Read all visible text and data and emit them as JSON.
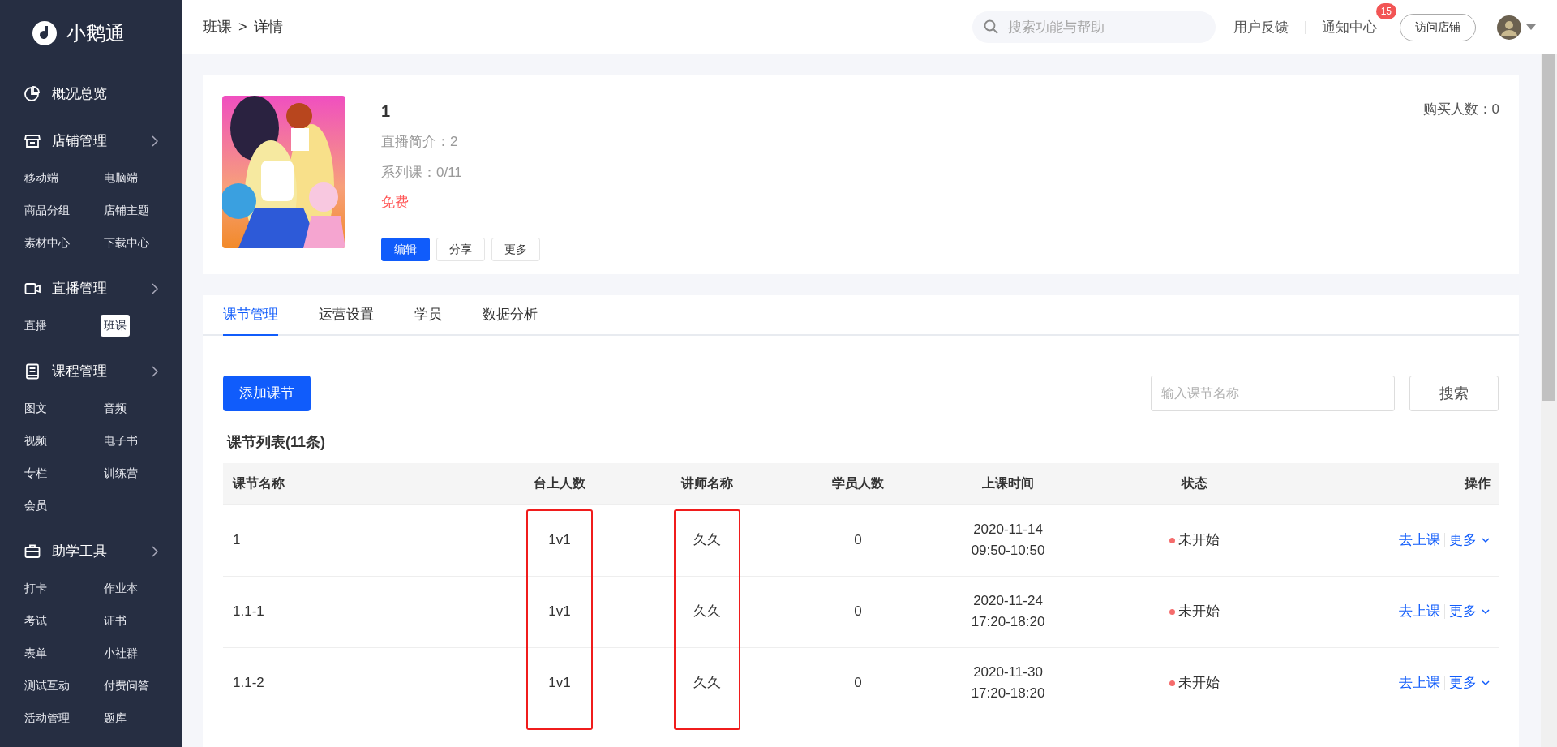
{
  "sidebar": {
    "logo": "小鹅通",
    "sections": [
      {
        "title": "概况总览",
        "kind": "pie",
        "expandable": false
      },
      {
        "title": "店铺管理",
        "kind": "store",
        "expandable": true,
        "items": [
          {
            "label": "移动端",
            "selected": false
          },
          {
            "label": "电脑端",
            "selected": false
          },
          {
            "label": "商品分组",
            "selected": false
          },
          {
            "label": "店铺主题",
            "selected": false
          },
          {
            "label": "素材中心",
            "selected": false
          },
          {
            "label": "下载中心",
            "selected": false
          }
        ]
      },
      {
        "title": "直播管理",
        "kind": "camera",
        "expandable": true,
        "items": [
          {
            "label": "直播",
            "selected": false
          },
          {
            "label": "班课",
            "selected": true
          }
        ]
      },
      {
        "title": "课程管理",
        "kind": "book",
        "expandable": true,
        "items": [
          {
            "label": "图文",
            "selected": false
          },
          {
            "label": "音频",
            "selected": false
          },
          {
            "label": "视频",
            "selected": false
          },
          {
            "label": "电子书",
            "selected": false
          },
          {
            "label": "专栏",
            "selected": false
          },
          {
            "label": "训练营",
            "selected": false
          },
          {
            "label": "会员",
            "selected": false
          }
        ]
      },
      {
        "title": "助学工具",
        "kind": "briefcase",
        "expandable": true,
        "items": [
          {
            "label": "打卡",
            "selected": false
          },
          {
            "label": "作业本",
            "selected": false
          },
          {
            "label": "考试",
            "selected": false
          },
          {
            "label": "证书",
            "selected": false
          },
          {
            "label": "表单",
            "selected": false
          },
          {
            "label": "小社群",
            "selected": false
          },
          {
            "label": "测试互动",
            "selected": false
          },
          {
            "label": "付费问答",
            "selected": false
          },
          {
            "label": "活动管理",
            "selected": false
          },
          {
            "label": "题库",
            "selected": false
          }
        ]
      }
    ]
  },
  "header": {
    "breadcrumb": [
      "班课",
      "详情"
    ],
    "separator": ">",
    "search": {
      "placeholder": "搜索功能与帮助"
    },
    "feedback": "用户反馈",
    "notifications": {
      "label": "通知中心",
      "badge": "15"
    },
    "visit_button": "访问店铺"
  },
  "course": {
    "kind": "picture",
    "title": "1",
    "details": [
      "直播简介：2",
      "系列课：0/11"
    ],
    "price": "免费",
    "buyers": "购买人数：0",
    "buttons": [
      {
        "label": "编辑",
        "kind": "primary"
      },
      {
        "label": "分享",
        "kind": "plain"
      },
      {
        "label": "更多",
        "kind": "plain"
      }
    ]
  },
  "tabs": [
    {
      "label": "课节管理",
      "selected": true
    },
    {
      "label": "运营设置",
      "selected": false
    },
    {
      "label": "学员",
      "selected": false
    },
    {
      "label": "数据分析",
      "selected": false
    }
  ],
  "toolbar": {
    "add_button": "添加课节",
    "search": {
      "placeholder": "输入课节名称"
    },
    "search_button": "搜索"
  },
  "list_title": "课节列表(11条)",
  "table": {
    "columns": [
      {
        "label": "课节名称",
        "highlighted": false
      },
      {
        "label": "台上人数",
        "highlighted": true
      },
      {
        "label": "讲师名称",
        "highlighted": true
      },
      {
        "label": "学员人数",
        "highlighted": false
      },
      {
        "label": "上课时间",
        "highlighted": false
      },
      {
        "label": "状态",
        "highlighted": false
      },
      {
        "label": "操作",
        "highlighted": false
      }
    ],
    "rows": [
      {
        "name": "1",
        "stage": "1v1",
        "teacher": "久久",
        "students": "0",
        "date": "2020-11-14",
        "time": "09:50-10:50",
        "status": {
          "label": "未开始",
          "color": "#f56c6c"
        },
        "actions": [
          "去上课",
          "更多"
        ]
      },
      {
        "name": "1.1-1",
        "stage": "1v1",
        "teacher": "久久",
        "students": "0",
        "date": "2020-11-24",
        "time": "17:20-18:20",
        "status": {
          "label": "未开始",
          "color": "#f56c6c"
        },
        "actions": [
          "去上课",
          "更多"
        ]
      },
      {
        "name": "1.1-2",
        "stage": "1v1",
        "teacher": "久久",
        "students": "0",
        "date": "2020-11-30",
        "time": "17:20-18:20",
        "status": {
          "label": "未开始",
          "color": "#f56c6c"
        },
        "actions": [
          "去上课",
          "更多"
        ]
      }
    ]
  }
}
